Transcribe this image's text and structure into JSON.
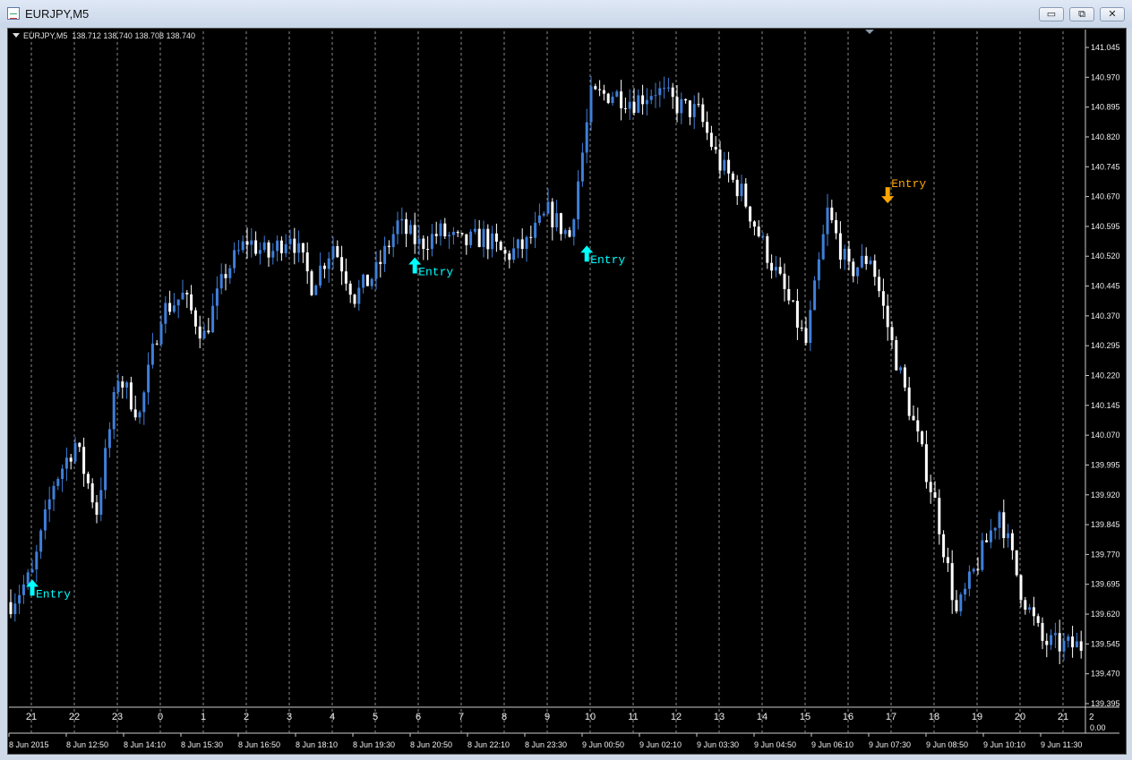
{
  "window": {
    "title": "EURJPY,M5"
  },
  "buttons": {
    "minimize": "▭",
    "restore": "⧉",
    "close": "✕"
  },
  "chart_info": {
    "symbol": "EURJPY,M5",
    "ohlc": "138.712 138.740 138.708 138.740"
  },
  "chart_data": {
    "type": "candlestick",
    "symbol": "EURJPY",
    "timeframe": "M5",
    "price_ticks": [
      "141.045",
      "140.970",
      "140.895",
      "140.820",
      "140.745",
      "140.670",
      "140.595",
      "140.520",
      "140.445",
      "140.370",
      "140.295",
      "140.220",
      "140.145",
      "140.070",
      "139.995",
      "139.920",
      "139.845",
      "139.770",
      "139.695",
      "139.620",
      "139.545",
      "139.470",
      "139.395"
    ],
    "hour_labels": [
      "21",
      "22",
      "23",
      "0",
      "1",
      "2",
      "3",
      "4",
      "5",
      "6",
      "7",
      "8",
      "9",
      "10",
      "11",
      "12",
      "13",
      "14",
      "15",
      "16",
      "17",
      "18",
      "19",
      "20",
      "21",
      "2"
    ],
    "time_labels": [
      "8 Jun 2015",
      "8 Jun 12:50",
      "8 Jun 14:10",
      "8 Jun 15:30",
      "8 Jun 16:50",
      "8 Jun 18:10",
      "8 Jun 19:30",
      "8 Jun 20:50",
      "8 Jun 22:10",
      "8 Jun 23:30",
      "9 Jun 00:50",
      "9 Jun 02:10",
      "9 Jun 03:30",
      "9 Jun 04:50",
      "9 Jun 06:10",
      "9 Jun 07:30",
      "9 Jun 08:50",
      "9 Jun 10:10",
      "9 Jun 11:30"
    ],
    "sub_axis_value": "0.00",
    "ylim": [
      139.395,
      141.045
    ],
    "up_color": "#3f7fd9",
    "down_color": "#ffffff",
    "path": [
      [
        0,
        139.65
      ],
      [
        5,
        139.72
      ],
      [
        10,
        139.95
      ],
      [
        15,
        140.05
      ],
      [
        20,
        139.88
      ],
      [
        25,
        140.22
      ],
      [
        30,
        140.12
      ],
      [
        35,
        140.38
      ],
      [
        40,
        140.42
      ],
      [
        45,
        140.32
      ],
      [
        50,
        140.48
      ],
      [
        55,
        140.56
      ],
      [
        60,
        140.52
      ],
      [
        65,
        140.58
      ],
      [
        70,
        140.45
      ],
      [
        75,
        140.55
      ],
      [
        80,
        140.42
      ],
      [
        85,
        140.48
      ],
      [
        90,
        140.6
      ],
      [
        95,
        140.55
      ],
      [
        100,
        140.58
      ],
      [
        105,
        140.55
      ],
      [
        110,
        140.57
      ],
      [
        115,
        140.52
      ],
      [
        120,
        140.55
      ],
      [
        125,
        140.63
      ],
      [
        130,
        140.57
      ],
      [
        135,
        140.92
      ],
      [
        140,
        140.93
      ],
      [
        145,
        140.91
      ],
      [
        150,
        140.94
      ],
      [
        155,
        140.9
      ],
      [
        160,
        140.88
      ],
      [
        165,
        140.75
      ],
      [
        170,
        140.68
      ],
      [
        175,
        140.55
      ],
      [
        180,
        140.43
      ],
      [
        185,
        140.3
      ],
      [
        190,
        140.63
      ],
      [
        195,
        140.48
      ],
      [
        200,
        140.52
      ],
      [
        205,
        140.3
      ],
      [
        210,
        140.1
      ],
      [
        215,
        139.9
      ],
      [
        220,
        139.62
      ],
      [
        225,
        139.75
      ],
      [
        230,
        139.88
      ],
      [
        235,
        139.68
      ],
      [
        240,
        139.55
      ],
      [
        245,
        139.54
      ]
    ],
    "signals": [
      {
        "label": "Entry",
        "direction": "up",
        "bar": 5,
        "price": 139.68
      },
      {
        "label": "Entry",
        "direction": "up",
        "bar": 94,
        "price": 140.49
      },
      {
        "label": "Entry",
        "direction": "up",
        "bar": 134,
        "price": 140.52
      },
      {
        "label": "Entry",
        "direction": "down",
        "bar": 204,
        "price": 140.68
      }
    ],
    "signal_up_color": "#00ffff",
    "signal_down_color": "#ffa500",
    "grid": true
  }
}
